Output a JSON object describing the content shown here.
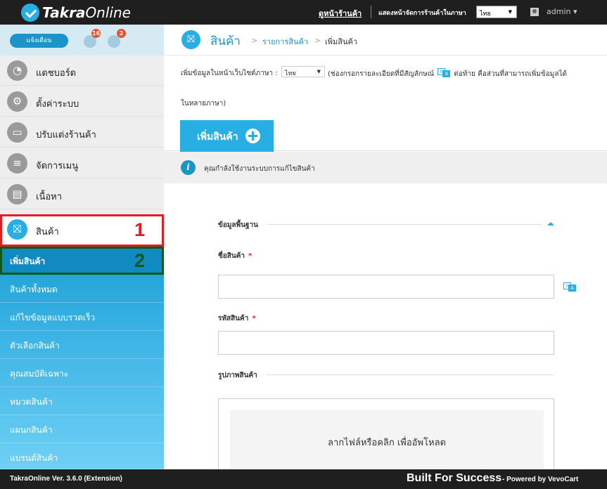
{
  "topbar": {
    "logo_bold": "Takra",
    "logo_light": "Online",
    "view_store": "ดูหน้าร้านค้า",
    "lang_label": "แสดงหน้าจัดการร้านค้าในภาษา",
    "lang_value": "ไทย",
    "user": "admin",
    "user_caret": "▾"
  },
  "sidebar": {
    "notify_label": "แจ้งเตือน",
    "cart_count": "16",
    "user_count": "2",
    "items": [
      {
        "label": "แดชบอร์ด",
        "icon": "dashboard-icon"
      },
      {
        "label": "ตั้งค่าระบบ",
        "icon": "gears-icon"
      },
      {
        "label": "ปรับแต่งร้านค้า",
        "icon": "monitor-icon"
      },
      {
        "label": "จัดการเมนู",
        "icon": "menu-icon"
      },
      {
        "label": "เนื้อหา",
        "icon": "document-icon"
      },
      {
        "label": "สินค้า",
        "icon": "gift-icon"
      }
    ],
    "sub_items": [
      "เพิ่มสินค้า",
      "สินค้าทั้งหมด",
      "แก้ไขข้อมูลแบบรวดเร็ว",
      "ตัวเลือกสินค้า",
      "คุณสมบัติเฉพาะ",
      "หมวดสินค้า",
      "แผนกสินค้า",
      "แบรนด์สินค้า"
    ],
    "marker_1": "1",
    "marker_2": "2",
    "colors": {
      "active_border": "#e51c23",
      "sub_active_border": "#0f5a1a",
      "accent": "#29aee3"
    }
  },
  "main": {
    "title": "สินค้า",
    "breadcrumb_1": "รายการสินค้า",
    "breadcrumb_2": "เพิ่มสินค้า",
    "breadcrumb_sep": ">",
    "lang_prefix": "เพิ่มข้อมูลในหน้าเว็บไซต์ภาษา :",
    "lang_value": "ไทย",
    "lang_note": "(ช่องกรอกรายละเอียดที่มีสัญลักษณ์",
    "lang_note_tail": "ต่อท้าย คือส่วนที่สามารถเพิ่มข้อมูลได้",
    "lang_note_2": "ในหลายภาษา)",
    "add_tab": "เพิ่มสินค้า",
    "info_text": "คุณกำลังใช้งานระบบการแก้ไขสินค้า",
    "section_basic": "ข้อมูลพื้นฐาน",
    "field_name": "ชื่อสินค้า",
    "field_code": "รหัสสินค้า",
    "required_mark": "*",
    "section_images": "รูปภาพสินค้า",
    "upload_text": "ลากไฟล์หรือคลิก เพื่ออัพโหลด",
    "icon_glyph": "⛝",
    "trans_a": "n",
    "trans_b": "A"
  },
  "footer": {
    "version": "TakraOnline Ver. 3.6.0 (Extension)",
    "tagline": "Built For Success",
    "powered": "- Powered by VevoCart"
  }
}
